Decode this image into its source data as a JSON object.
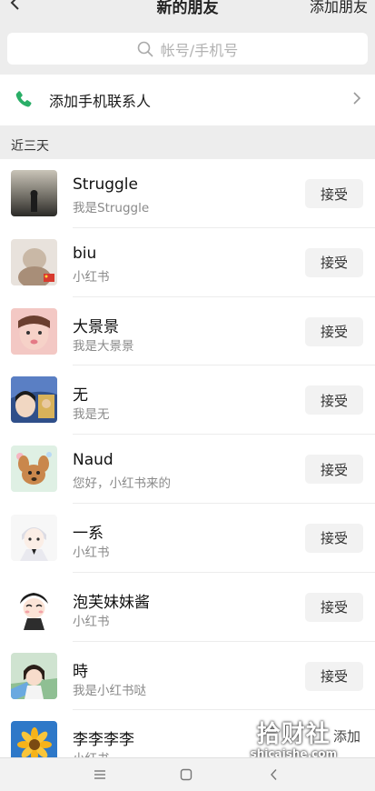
{
  "header": {
    "title": "新的朋友",
    "action_label": "添加朋友"
  },
  "search": {
    "placeholder": "帐号/手机号"
  },
  "phone_contacts": {
    "label": "添加手机联系人"
  },
  "section": {
    "label": "近三天"
  },
  "requests": [
    {
      "name": "Struggle",
      "message": "我是Struggle",
      "action": "接受"
    },
    {
      "name": "biu",
      "message": "小红书",
      "action": "接受"
    },
    {
      "name": "大景景",
      "message": "我是大景景",
      "action": "接受"
    },
    {
      "name": "无",
      "message": "我是无",
      "action": "接受"
    },
    {
      "name": "Naud",
      "message": "您好，小红书来的",
      "action": "接受"
    },
    {
      "name": "一系",
      "message": "小红书",
      "action": "接受"
    },
    {
      "name": "泡芙妹妹酱",
      "message": "小红书",
      "action": "接受"
    },
    {
      "name": "時",
      "message": "我是小红书哒",
      "action": "接受"
    },
    {
      "name": "李李李李",
      "message": "小红书",
      "action": "添加"
    }
  ],
  "watermark": {
    "text_cn": "拾财社",
    "text_en": "shicaishe.com"
  },
  "colors": {
    "phone_icon": "#2aae67",
    "accept_bg": "#f2f2f2",
    "page_bg": "#ededed"
  }
}
